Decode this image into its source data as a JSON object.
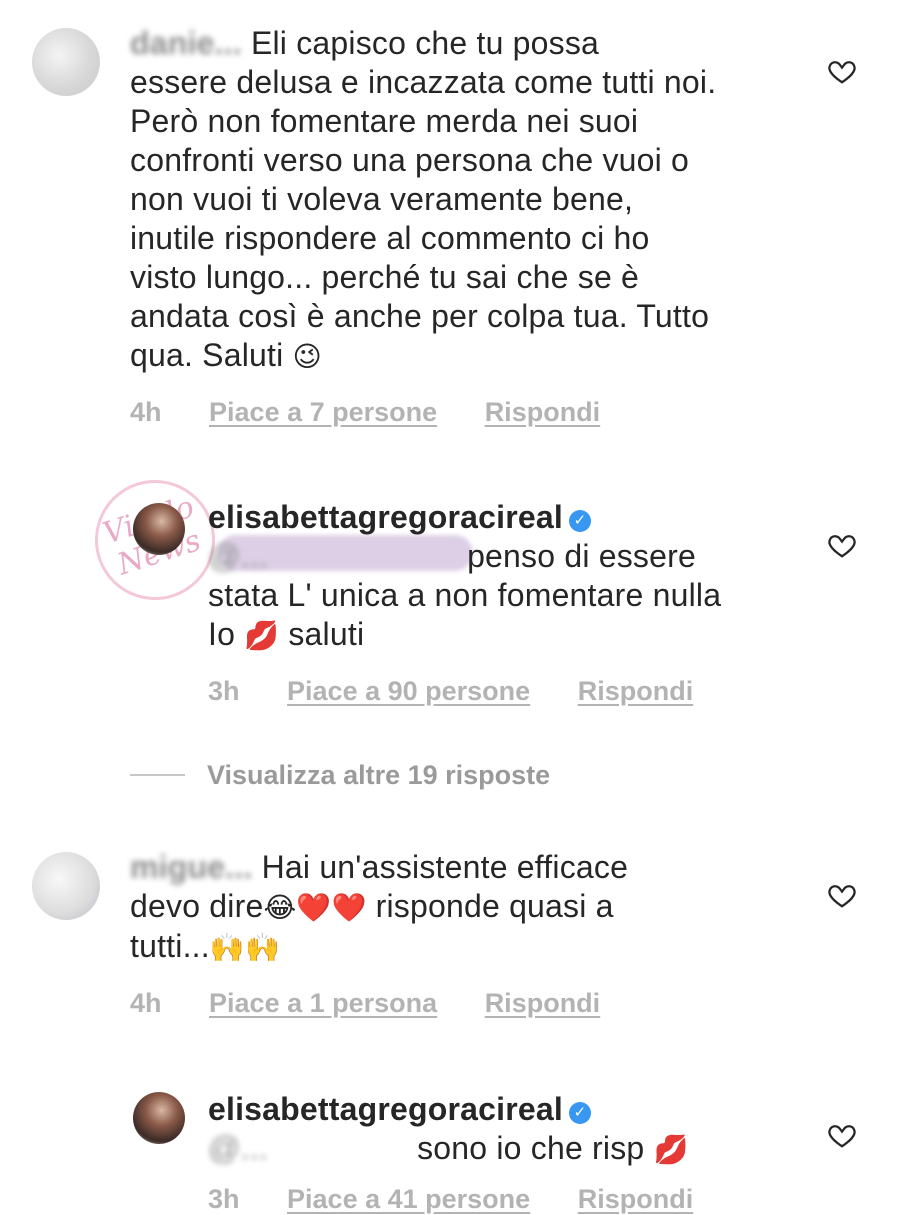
{
  "comments": [
    {
      "username": "danie...",
      "text_lines": [
        "Eli capisco che tu possa",
        "essere delusa e incazzata come tutti noi.",
        "Però non fomentare merda nei suoi",
        "confronti verso una persona che vuoi o",
        "non vuoi ti voleva veramente bene,",
        "inutile rispondere al commento ci ho",
        "visto lungo... perché tu sai che se è",
        "andata così è anche per colpa tua. Tutto",
        "qua. Saluti"
      ],
      "emoji": "😉",
      "time": "4h",
      "likes": "Piace a 7 persone",
      "reply": "Rispondi"
    },
    {
      "username": "elisabettagregoracireal",
      "mention": "@...",
      "text_lines": [
        "penso di essere",
        "stata L' unica a non fomentare nulla",
        "Io"
      ],
      "emoji": "💋",
      "text_end": "saluti",
      "time": "3h",
      "likes": "Piace a 90 persone",
      "reply": "Rispondi"
    },
    {
      "username": "migue...",
      "text_lines": [
        "Hai un'assistente efficace",
        "devo dire",
        "risponde quasi a",
        "tutti..."
      ],
      "emoji_laugh": "😂",
      "emoji_heart": "❤️",
      "emoji_hands": "🙌",
      "time": "4h",
      "likes": "Piace a 1 persona",
      "reply": "Rispondi"
    },
    {
      "username": "elisabettagregoracireal",
      "mention": "@...",
      "text": "sono io che risp",
      "emoji": "💋",
      "time": "3h",
      "likes": "Piace a 41 persone",
      "reply": "Rispondi"
    }
  ],
  "view_more": "Visualizza altre 19 risposte",
  "watermark": "Vicolo delle News",
  "icons": {
    "heart": "heart-outline-icon",
    "verified": "verified-badge-icon"
  },
  "colors": {
    "text": "#262626",
    "meta": "#b3b3b3",
    "verified": "#3897f0"
  }
}
